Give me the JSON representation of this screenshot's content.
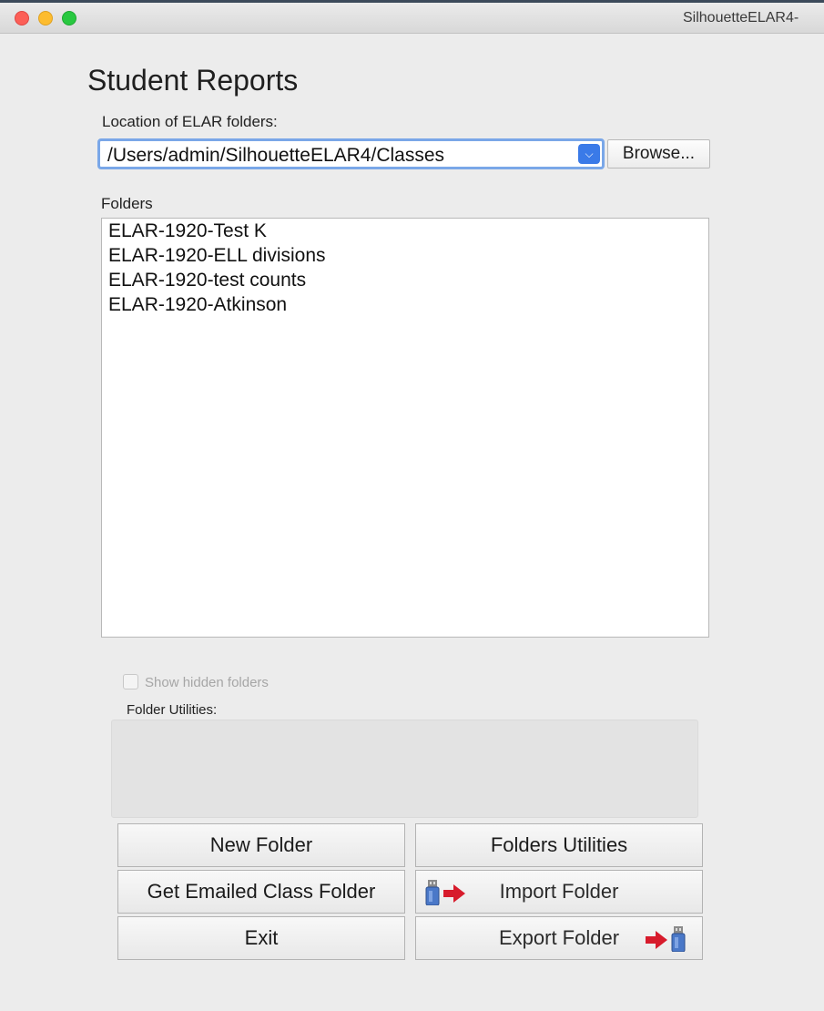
{
  "window": {
    "title": "SilhouetteELAR4-"
  },
  "heading": "Student Reports",
  "location": {
    "label": "Location of ELAR folders:",
    "path": "/Users/admin/SilhouetteELAR4/Classes",
    "browse_label": "Browse..."
  },
  "folders": {
    "label": "Folders",
    "items": [
      "ELAR-1920-Test K",
      "ELAR-1920-ELL divisions",
      "ELAR-1920-test counts",
      "ELAR-1920-Atkinson"
    ]
  },
  "show_hidden": {
    "label": "Show hidden folders",
    "checked": false,
    "enabled": false
  },
  "utilities": {
    "label": "Folder Utilities:"
  },
  "buttons": {
    "new_folder": "New Folder",
    "folders_utilities": "Folders Utilities",
    "get_emailed": "Get Emailed Class Folder",
    "import_folder": "Import Folder",
    "exit": "Exit",
    "export_folder": "Export Folder"
  },
  "icons": {
    "usb_import": "usb-drive-arrow-in-icon",
    "usb_export": "arrow-usb-drive-out-icon"
  },
  "colors": {
    "accent": "#3a7ae8",
    "arrow_red": "#d71b2c",
    "usb_blue": "#4a78c8"
  }
}
